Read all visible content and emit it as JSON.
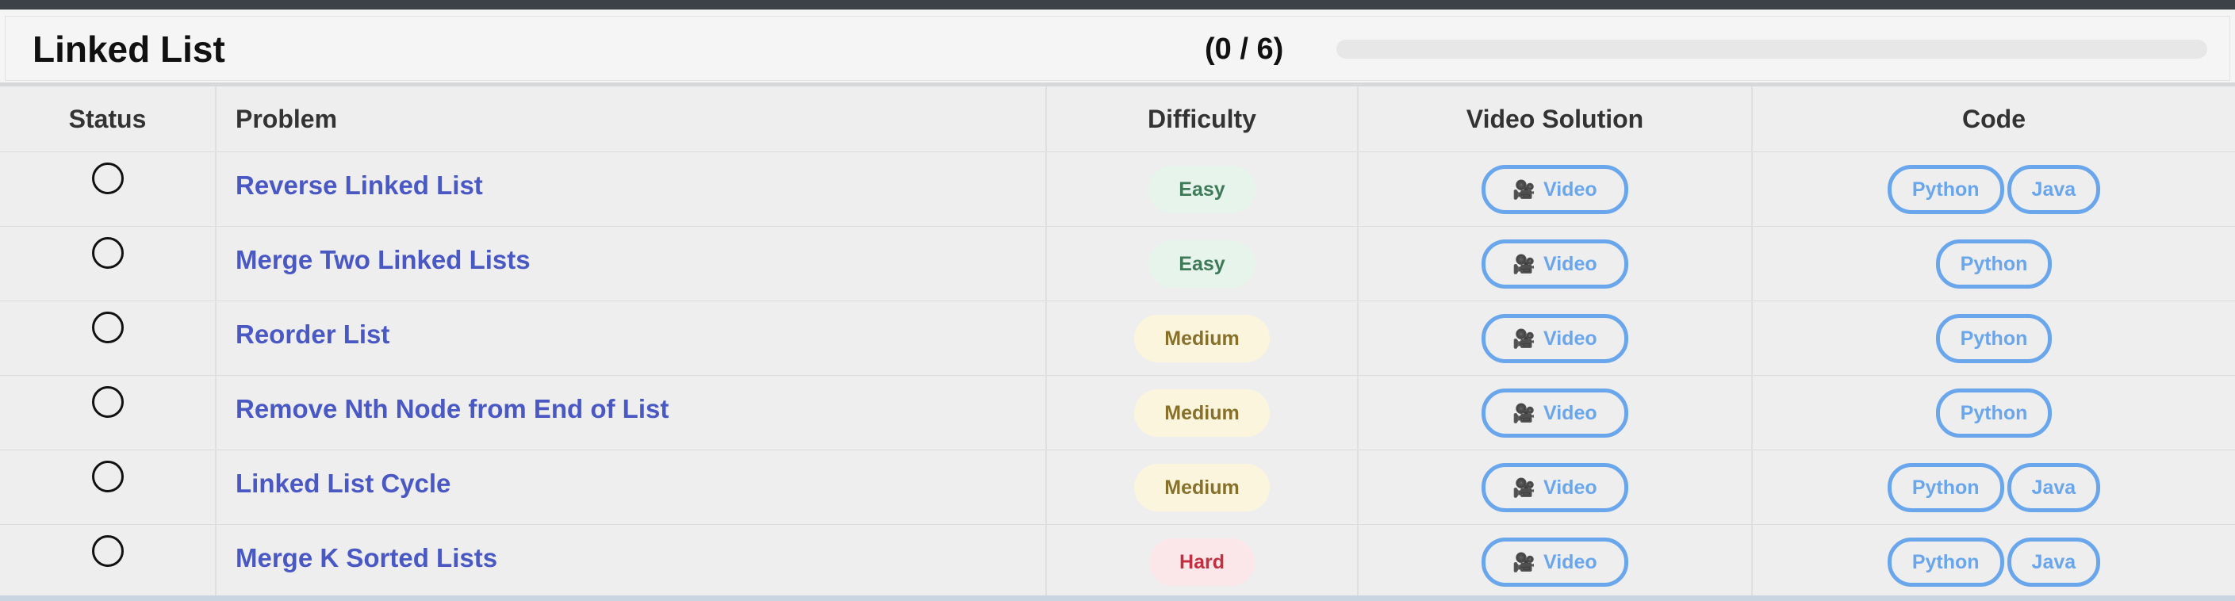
{
  "header": {
    "title": "Linked List",
    "count": "(0 / 6)",
    "progress": 0
  },
  "columns": [
    "Status",
    "Problem",
    "Difficulty",
    "Video Solution",
    "Code"
  ],
  "video_label": "Video",
  "rows": [
    {
      "problem": "Reverse Linked List",
      "difficulty": "Easy",
      "level": "easy",
      "code": [
        "Python",
        "Java"
      ]
    },
    {
      "problem": "Merge Two Linked Lists",
      "difficulty": "Easy",
      "level": "easy",
      "code": [
        "Python"
      ]
    },
    {
      "problem": "Reorder List",
      "difficulty": "Medium",
      "level": "medium",
      "code": [
        "Python"
      ]
    },
    {
      "problem": "Remove Nth Node from End of List",
      "difficulty": "Medium",
      "level": "medium",
      "code": [
        "Python"
      ]
    },
    {
      "problem": "Linked List Cycle",
      "difficulty": "Medium",
      "level": "medium",
      "code": [
        "Python",
        "Java"
      ]
    },
    {
      "problem": "Merge K Sorted Lists",
      "difficulty": "Hard",
      "level": "hard",
      "code": [
        "Python",
        "Java"
      ]
    }
  ],
  "colors": {
    "link": "#4a58c4",
    "button": "#6aa6eb",
    "topbar": "#3d4148"
  }
}
